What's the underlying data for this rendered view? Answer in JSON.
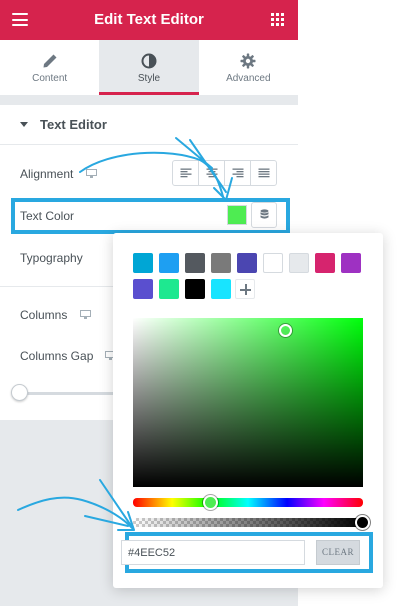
{
  "header": {
    "title": "Edit Text Editor",
    "menu_icon": "hamburger-icon",
    "apps_icon": "grid-icon"
  },
  "tabs": [
    {
      "label": "Content",
      "icon": "pencil-icon",
      "active": false
    },
    {
      "label": "Style",
      "icon": "half-circle-icon",
      "active": true
    },
    {
      "label": "Advanced",
      "icon": "gear-icon",
      "active": false
    }
  ],
  "section": {
    "title": "Text Editor",
    "expanded": true
  },
  "controls": {
    "alignment": {
      "label": "Alignment",
      "options": [
        "left",
        "center",
        "right",
        "justify"
      ]
    },
    "text_color": {
      "label": "Text Color",
      "value": "#4EEC52"
    },
    "typography": {
      "label": "Typography"
    },
    "columns": {
      "label": "Columns"
    },
    "columns_gap": {
      "label": "Columns Gap",
      "slider_value_fraction": 0
    }
  },
  "color_picker": {
    "swatches": [
      "#00a6d5",
      "#1e9ff2",
      "#54595f",
      "#7a7a7a",
      "#4b46b1",
      "#ffffff",
      "#e6e9ec",
      "#d6246e",
      "#9e31c2",
      "#5a4fcf",
      "#1ee890",
      "#000000",
      "#18e4ff"
    ],
    "hex_value": "#4EEC52",
    "clear_label": "CLEAR",
    "hue_color": "#00ff0c",
    "alpha": 1
  },
  "colors": {
    "brand": "#d6234d",
    "highlight": "#29a8e0"
  }
}
